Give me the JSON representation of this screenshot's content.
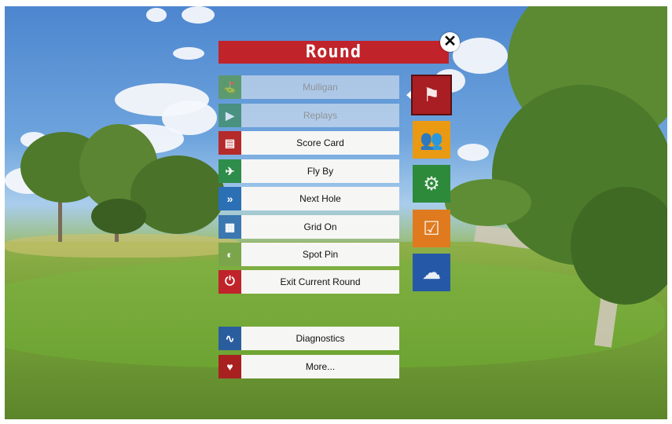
{
  "menu": {
    "title": "Round",
    "close_icon": "close-icon",
    "items": [
      {
        "label": "Mulligan",
        "icon": "mulligan-icon",
        "enabled": false,
        "color": "#5a9a44"
      },
      {
        "label": "Replays",
        "icon": "replay-icon",
        "enabled": false,
        "color": "#3d8c5a"
      },
      {
        "label": "Score Card",
        "icon": "scorecard-icon",
        "enabled": true,
        "color": "#b52a2a"
      },
      {
        "label": "Fly By",
        "icon": "flyby-icon",
        "enabled": true,
        "color": "#2e8d4a"
      },
      {
        "label": "Next Hole",
        "icon": "next-hole-icon",
        "enabled": true,
        "color": "#2b6fb5"
      },
      {
        "label": "Grid On",
        "icon": "grid-icon",
        "enabled": true,
        "color": "#3b77b0"
      },
      {
        "label": "Spot Pin",
        "icon": "spot-pin-icon",
        "enabled": true,
        "color": "#7aa54a"
      },
      {
        "label": "Exit Current Round",
        "icon": "power-icon",
        "enabled": true,
        "color": "#c0232a"
      }
    ],
    "extra_items": [
      {
        "label": "Diagnostics",
        "icon": "heartbeat-icon",
        "color": "#2a5d9e"
      },
      {
        "label": "More...",
        "icon": "more-icon",
        "color": "#a8201f"
      }
    ]
  },
  "categories": [
    {
      "name": "round-category",
      "icon": "flag-icon",
      "color": "#a81e22",
      "active": true
    },
    {
      "name": "players-category",
      "icon": "players-icon",
      "color": "#e99a12",
      "active": false
    },
    {
      "name": "settings-category",
      "icon": "gear-icon",
      "color": "#2d8a3a",
      "active": false
    },
    {
      "name": "checklist-category",
      "icon": "checkbox-icon",
      "color": "#e07a1f",
      "active": false
    },
    {
      "name": "weather-category",
      "icon": "weather-icon",
      "color": "#2559a8",
      "active": false
    }
  ],
  "colors": {
    "title_bar": "#c0232a",
    "button_bg": "#f6f6f4"
  }
}
